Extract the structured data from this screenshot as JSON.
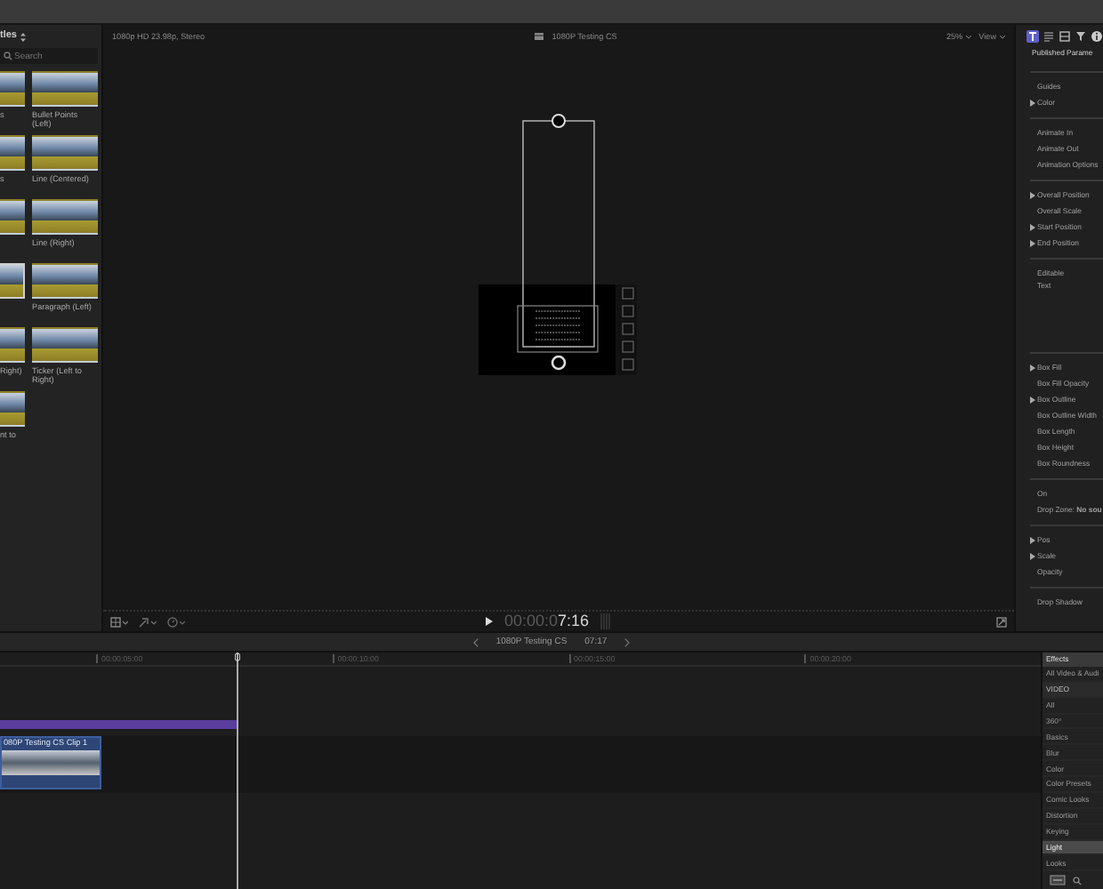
{
  "browser": {
    "title": "tles",
    "search_placeholder": "Search",
    "items": [
      {
        "label": "s",
        "selected": false
      },
      {
        "label": "Bullet Points (Left)",
        "selected": false
      },
      {
        "label": "s",
        "selected": false
      },
      {
        "label": "Line (Centered)",
        "selected": false
      },
      {
        "selected": false
      },
      {
        "label": "Line (Right)",
        "selected": false
      },
      {
        "selected": true
      },
      {
        "label": "Paragraph (Left)",
        "selected": false
      },
      {
        "label": "Right)",
        "selected": false
      },
      {
        "label": "Ticker (Left to Right)",
        "selected": false
      },
      {
        "label": "nt to",
        "selected": false
      }
    ]
  },
  "viewer": {
    "format": "1080p HD 23.98p, Stereo",
    "project": "1080P Testing CS",
    "zoom": "25%",
    "view": "View",
    "timecode_dim": "00:00:0",
    "timecode": "7:16"
  },
  "inspector": {
    "tabs": [
      {
        "kind": "title",
        "selected": true
      },
      {
        "kind": "text",
        "selected": false
      },
      {
        "kind": "video",
        "selected": false
      },
      {
        "kind": "filter",
        "selected": false
      },
      {
        "kind": "info",
        "selected": false
      }
    ],
    "title": "Published Parame",
    "groups": [
      {
        "items": [
          {
            "label": "Guides",
            "disclosure": false
          },
          {
            "label": "Color",
            "disclosure": true
          }
        ]
      },
      {
        "items": [
          {
            "label": "Animate In",
            "disclosure": false
          },
          {
            "label": "Animate Out",
            "disclosure": false
          },
          {
            "label": "Animation Options",
            "disclosure": false
          }
        ]
      },
      {
        "items": [
          {
            "label": "Overall Position",
            "disclosure": true
          },
          {
            "label": "Overall Scale",
            "disclosure": false
          },
          {
            "label": "Start Position",
            "disclosure": true
          },
          {
            "label": "End Position",
            "disclosure": true
          }
        ]
      },
      {
        "items": [
          {
            "label": "Editable",
            "disclosure": false
          },
          {
            "label": "Text",
            "disclosure": false,
            "kind": "tall"
          }
        ]
      },
      {
        "items": [
          {
            "label": "Box Fill",
            "disclosure": true
          },
          {
            "label": "Box Fill Opacity",
            "disclosure": false
          },
          {
            "label": "Box Outline",
            "disclosure": true
          },
          {
            "label": "Box Outline Width",
            "disclosure": false
          },
          {
            "label": "Box Length",
            "disclosure": false
          },
          {
            "label": "Box Height",
            "disclosure": false
          },
          {
            "label": "Box Roundness",
            "disclosure": false
          }
        ]
      },
      {
        "items": [
          {
            "label": "On",
            "disclosure": false
          },
          {
            "label": "Drop Zone: **No sou**",
            "disclosure": false
          }
        ]
      },
      {
        "items": [
          {
            "label": "Pos",
            "disclosure": true
          },
          {
            "label": "Scale",
            "disclosure": true
          },
          {
            "label": "Opacity",
            "disclosure": false
          }
        ]
      },
      {
        "items": [
          {
            "label": "Drop Shadow",
            "disclosure": false
          }
        ]
      }
    ]
  },
  "timeline": {
    "project": "1080P Testing CS",
    "duration": "07:17",
    "ruler": [
      "00:00:05:00",
      "00:00:10:00",
      "00:00:15:00",
      "00:00:20:00"
    ],
    "clip": "080P Testing CS Clip 1"
  },
  "effects": {
    "title": "Effects",
    "items": [
      {
        "label": "All Video & Audi",
        "kind": "item",
        "selected": false
      },
      {
        "label": "VIDEO",
        "kind": "section",
        "selected": false
      },
      {
        "label": "All",
        "kind": "item",
        "selected": false
      },
      {
        "label": "360°",
        "kind": "item",
        "selected": false
      },
      {
        "label": "Basics",
        "kind": "item",
        "selected": false
      },
      {
        "label": "Blur",
        "kind": "item",
        "selected": false
      },
      {
        "label": "Color",
        "kind": "item",
        "selected": false
      },
      {
        "label": "Color Presets",
        "kind": "item",
        "selected": false
      },
      {
        "label": "Comic Looks",
        "kind": "item",
        "selected": false
      },
      {
        "label": "Distortion",
        "kind": "item",
        "selected": false
      },
      {
        "label": "Keying",
        "kind": "item",
        "selected": false
      },
      {
        "label": "Light",
        "kind": "item",
        "selected": true
      },
      {
        "label": "Looks",
        "kind": "item",
        "selected": false
      }
    ]
  }
}
